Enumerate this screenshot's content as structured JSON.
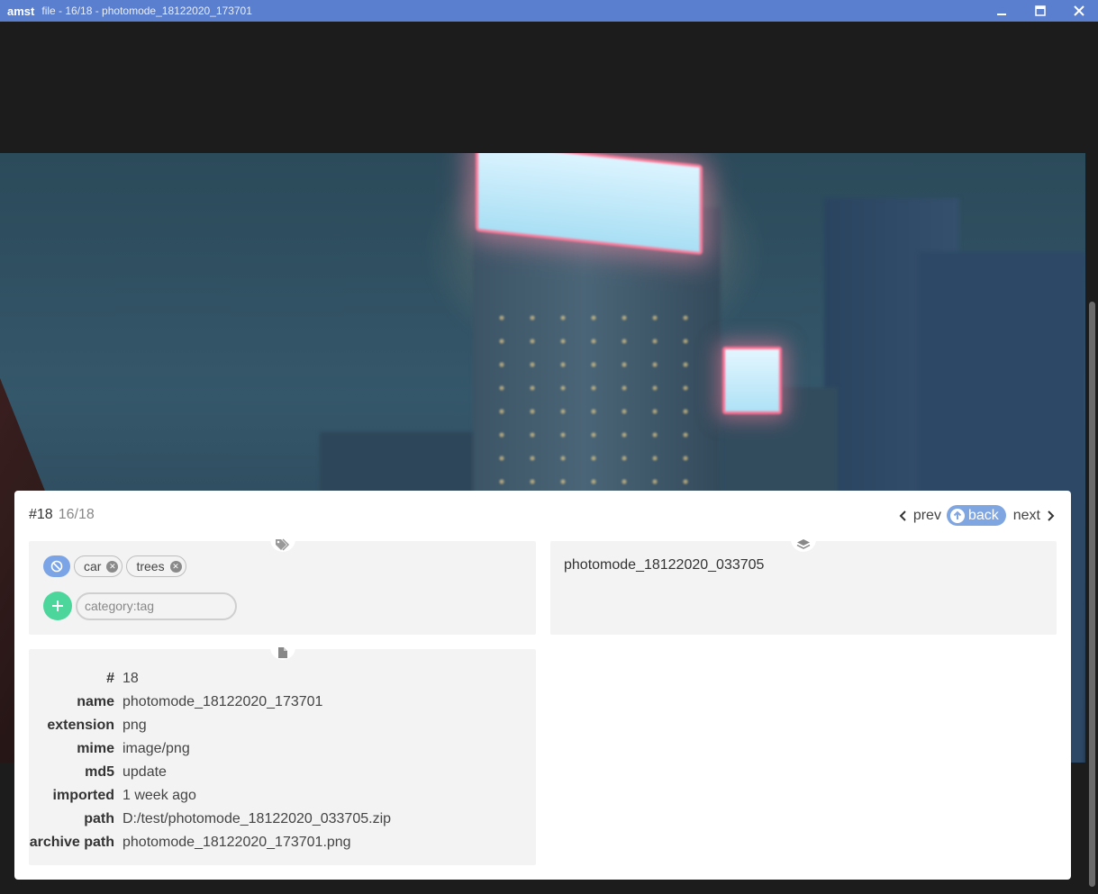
{
  "window": {
    "app": "amst",
    "title": "file - 16/18 - photomode_18122020_173701",
    "controls": [
      "minimize-icon",
      "maximize-icon",
      "close-icon"
    ]
  },
  "card": {
    "id": "#18",
    "position": "16/18",
    "nav": {
      "prev": "prev",
      "back": "back",
      "next": "next"
    }
  },
  "tags": {
    "items": [
      "car",
      "trees"
    ],
    "input_placeholder": "category:tag",
    "input_value": ""
  },
  "archive": {
    "name": "photomode_18122020_033705"
  },
  "meta": [
    {
      "key": "#",
      "value": "18"
    },
    {
      "key": "name",
      "value": "photomode_18122020_173701"
    },
    {
      "key": "extension",
      "value": "png"
    },
    {
      "key": "mime",
      "value": "image/png"
    },
    {
      "key": "md5",
      "value": "update"
    },
    {
      "key": "imported",
      "value": "1 week ago"
    },
    {
      "key": "path",
      "value": "D:/test/photomode_18122020_033705.zip"
    },
    {
      "key": "archive path",
      "value": "photomode_18122020_173701.png"
    }
  ],
  "colors": {
    "titlebar": "#5b7fcf",
    "back_button": "#7fa6e0",
    "add_button": "#4cd69c",
    "panel": "#f3f3f3"
  }
}
